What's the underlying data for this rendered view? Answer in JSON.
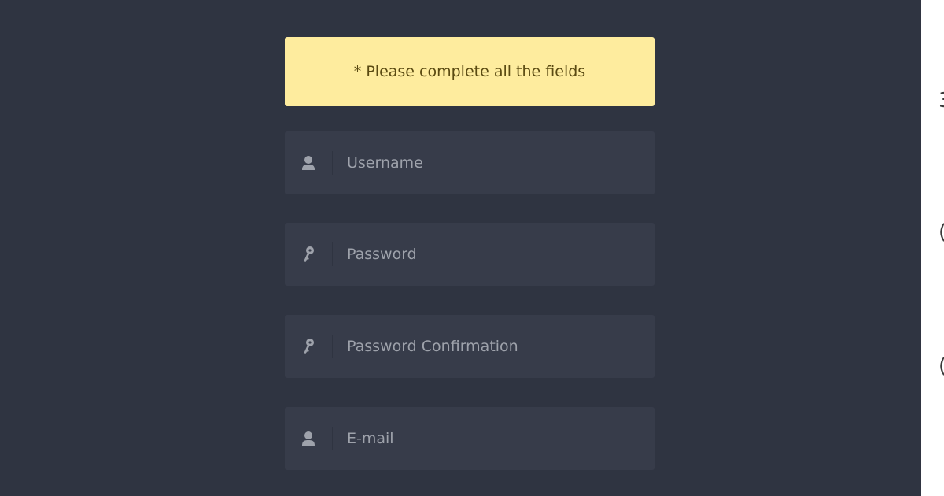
{
  "alert": {
    "message": "* Please complete all the fields",
    "background": "#feec9e"
  },
  "form": {
    "fields": [
      {
        "name": "username",
        "icon": "user-icon",
        "placeholder": "Username",
        "value": ""
      },
      {
        "name": "password",
        "icon": "key-icon",
        "placeholder": "Password",
        "value": ""
      },
      {
        "name": "password-confirmation",
        "icon": "key-icon",
        "placeholder": "Password Confirmation",
        "value": ""
      },
      {
        "name": "email",
        "icon": "user-icon",
        "placeholder": "E-mail",
        "value": ""
      }
    ]
  },
  "colors": {
    "page_background": "#2f3441",
    "field_background": "#373c4a",
    "icon_color": "#9ea2ab"
  },
  "right_edge": {
    "glyphs": [
      "3",
      "(",
      "("
    ]
  }
}
